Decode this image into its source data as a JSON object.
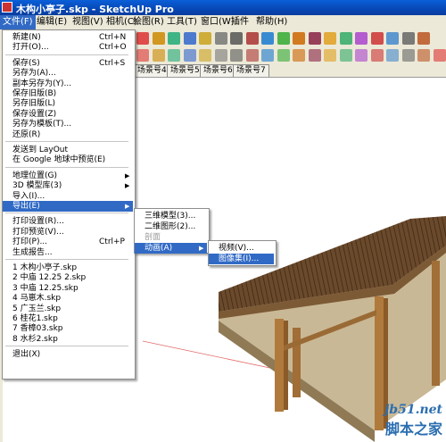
{
  "window": {
    "title": "木构小亭子.skp - SketchUp Pro"
  },
  "menubar": [
    {
      "label": "文件(F)",
      "active": true
    },
    {
      "label": "编辑(E)"
    },
    {
      "label": "视图(V)"
    },
    {
      "label": "相机(C)"
    },
    {
      "label": "绘图(R)"
    },
    {
      "label": "工具(T)"
    },
    {
      "label": "窗口(W)"
    },
    {
      "label": "插件"
    },
    {
      "label": "帮助(H)"
    }
  ],
  "file_menu": [
    {
      "label": "新建(N)",
      "shortcut": "Ctrl+N"
    },
    {
      "label": "打开(O)...",
      "shortcut": "Ctrl+O"
    },
    {
      "label": "保存(S)",
      "shortcut": "Ctrl+S"
    },
    {
      "label": "另存为(A)..."
    },
    {
      "label": "副本另存为(Y)..."
    },
    {
      "label": "保存旧版(B)"
    },
    {
      "label": "另存旧版(L)"
    },
    {
      "label": "保存设置(Z)"
    },
    {
      "label": "另存为模板(T)..."
    },
    {
      "label": "还原(R)"
    },
    {
      "label": "发送到 LayOut"
    },
    {
      "label": "在 Google 地球中预览(E)"
    },
    {
      "label": "地理位置(G)",
      "submenu": true
    },
    {
      "label": "3D 模型库(3)",
      "submenu": true
    },
    {
      "label": "导入(I)..."
    },
    {
      "label": "导出(E)",
      "submenu": true,
      "highlighted": true
    },
    {
      "label": "打印设置(R)..."
    },
    {
      "label": "打印预览(V)..."
    },
    {
      "label": "打印(P)...",
      "shortcut": "Ctrl+P"
    },
    {
      "label": "生成报告..."
    },
    {
      "label": "1 木构小亭子.skp"
    },
    {
      "label": "2 中庙 12.25 2.skp"
    },
    {
      "label": "3 中庙 12.25.skp"
    },
    {
      "label": "4 马崽木.skp"
    },
    {
      "label": "5 广玉兰.skp"
    },
    {
      "label": "6 桂花1.skp"
    },
    {
      "label": "7 香樟03.skp"
    },
    {
      "label": "8 水杉2.skp"
    },
    {
      "label": "退出(X)"
    }
  ],
  "export_submenu": [
    {
      "label": "三维模型(3)..."
    },
    {
      "label": "二维图形(2)..."
    },
    {
      "label": "剖面",
      "disabled": true
    },
    {
      "label": "动画(A)",
      "submenu": true,
      "highlighted": true
    }
  ],
  "animation_submenu": [
    {
      "label": "视频(V)..."
    },
    {
      "label": "图像集(I)...",
      "highlighted": true
    }
  ],
  "scene_tabs": [
    "场景号4",
    "场景号5",
    "场景号6",
    "场景号7"
  ],
  "toolbar": {
    "icons": [
      "rotate-icon",
      "move-icon",
      "refresh-icon",
      "scale-icon",
      "tape-measure-icon",
      "text-icon",
      "axes-icon",
      "dimensions-icon",
      "orbit-icon",
      "pan-icon",
      "zoom-icon",
      "zoom-extents-icon",
      "warehouse-icon",
      "share-icon",
      "components-icon",
      "get-model-icon",
      "eye-icon",
      "walk-icon",
      "section-icon",
      "arc-icon",
      "freehand-icon",
      "select-icon",
      "eraser-icon",
      "paint-icon",
      "push-pull-icon",
      "follow-me-icon",
      "offset-icon",
      "rectangle-icon",
      "circle-icon",
      "line-icon",
      "polygon-icon",
      "protractor-icon",
      "position-camera-icon",
      "look-around-icon",
      "sandbox-icon",
      "dropper-icon",
      "section-cut-icon",
      "layers-icon",
      "shadow-icon"
    ]
  },
  "watermark": {
    "line1": "jb51.net",
    "line2": "脚本之家"
  },
  "colors": {
    "titlebar": "#0747b5",
    "menu_highlight": "#316ac5",
    "chrome": "#ece9d8",
    "roof": "#5a3d24",
    "post": "#b07a3c"
  }
}
